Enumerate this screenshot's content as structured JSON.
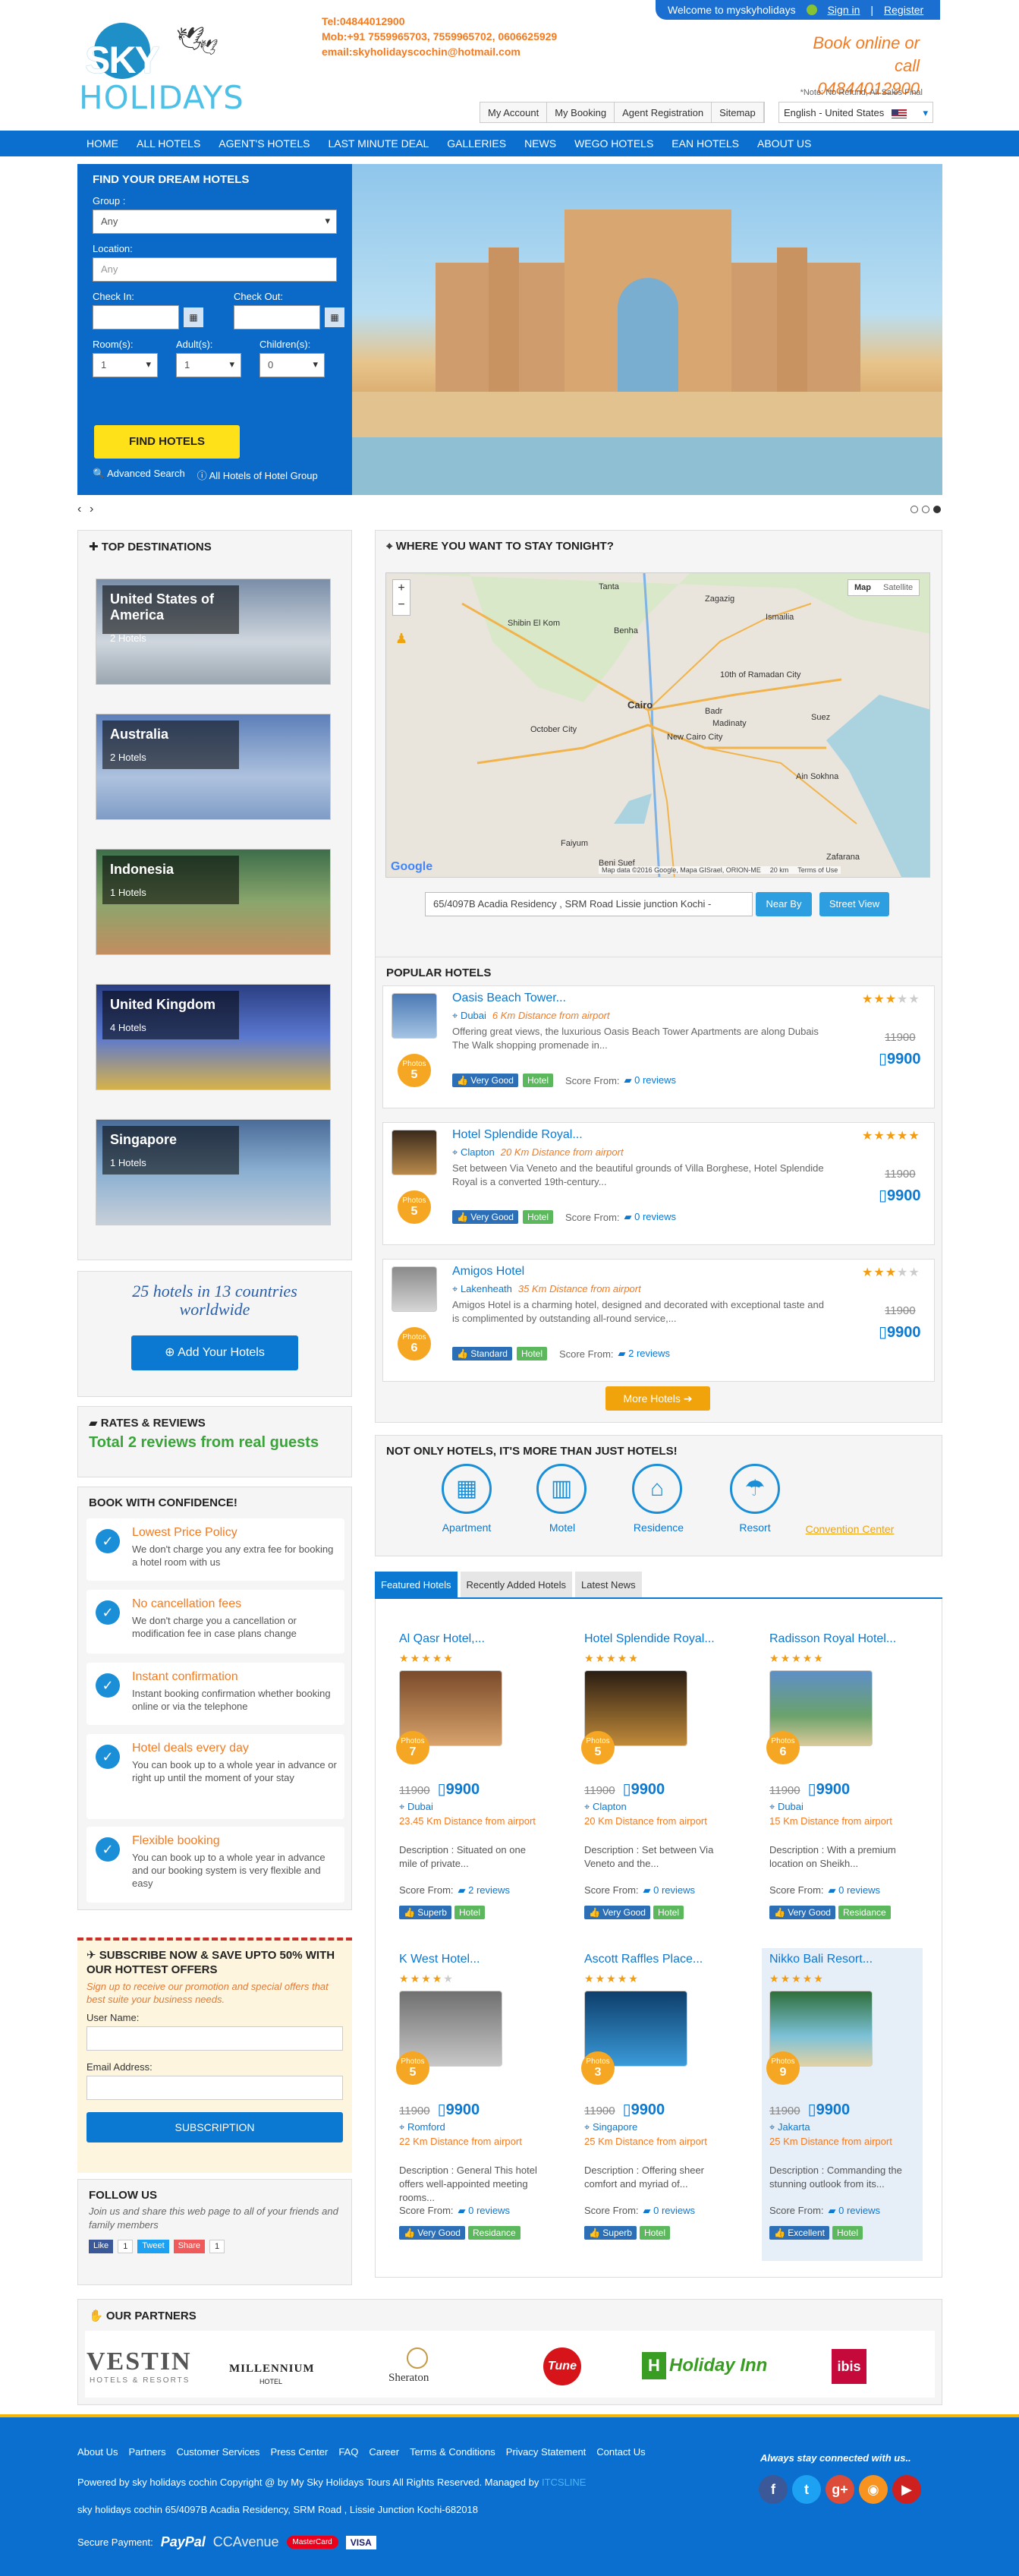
{
  "header": {
    "welcome": "Welcome to myskyholidays",
    "sign_in": "Sign in",
    "register": "Register",
    "logo_top": "SKY",
    "logo_bottom": "HOLIDAYS",
    "tel": "Tel:04844012900",
    "mob": "Mob:+91 7559965703, 7559965702, 0606625929",
    "email": "email:skyholidayscochin@hotmail.com",
    "book_online": "Book online or call",
    "phone": "04844012900",
    "note": "*Note: No Refund, All Sales Final",
    "top_links": [
      "My Account",
      "My Booking",
      "Agent Registration",
      "Sitemap"
    ],
    "language": "English - United States"
  },
  "nav": [
    "HOME",
    "ALL HOTELS",
    "AGENT'S HOTELS",
    "LAST MINUTE DEAL",
    "GALLERIES",
    "NEWS",
    "WEGO HOTELS",
    "EAN HOTELS",
    "ABOUT US"
  ],
  "search": {
    "title": "FIND YOUR DREAM HOTELS",
    "group_label": "Group :",
    "group_value": "Any",
    "location_label": "Location:",
    "location_placeholder": "Any",
    "checkin_label": "Check In:",
    "checkout_label": "Check Out:",
    "rooms_label": "Room(s):",
    "adults_label": "Adult(s):",
    "children_label": "Children(s):",
    "rooms_value": "1",
    "adults_value": "1",
    "children_value": "0",
    "button": "FIND HOTELS",
    "advanced": "Advanced Search",
    "all_hotels": "All Hotels of Hotel Group"
  },
  "destinations": {
    "title": "TOP DESTINATIONS",
    "items": [
      {
        "name": "United States of America",
        "count": "2 Hotels"
      },
      {
        "name": "Australia",
        "count": "2 Hotels"
      },
      {
        "name": "Indonesia",
        "count": "1 Hotels"
      },
      {
        "name": "United Kingdom",
        "count": "4 Hotels"
      },
      {
        "name": "Singapore",
        "count": "1 Hotels"
      }
    ]
  },
  "stats": {
    "text": "25 hotels in 13 countries worldwide",
    "add_button": "Add Your Hotels"
  },
  "reviews": {
    "title": "RATES & REVIEWS",
    "total": "Total 2 reviews from real guests"
  },
  "confidence": {
    "title": "BOOK WITH CONFIDENCE!",
    "items": [
      {
        "title": "Lowest Price Policy",
        "desc": "We don't charge you any extra fee for booking a hotel room with us"
      },
      {
        "title": "No cancellation fees",
        "desc": "We don't charge you a cancellation or modification fee in case plans change"
      },
      {
        "title": "Instant confirmation",
        "desc": "Instant booking confirmation whether booking online or via the telephone"
      },
      {
        "title": "Hotel deals every day",
        "desc": "You can book up to a whole year in advance or right up until the moment of your stay"
      },
      {
        "title": "Flexible booking",
        "desc": "You can book up to a whole year in advance and our booking system is very flexible and easy"
      }
    ]
  },
  "subscribe": {
    "title": "SUBSCRIBE NOW & SAVE UPTO 50% WITH OUR HOTTEST OFFERS",
    "desc": "Sign up to receive our promotion and special offers that best suite your business needs.",
    "user_label": "User Name:",
    "email_label": "Email Address:",
    "button": "SUBSCRIPTION"
  },
  "follow": {
    "title": "FOLLOW US",
    "desc": "Join us and share this web page to all of your friends and family members",
    "like": "Like",
    "like_count": "1",
    "tweet": "Tweet",
    "share": "Share",
    "share_count": "1"
  },
  "map": {
    "title": "WHERE YOU WANT TO STAY TONIGHT?",
    "type_map": "Map",
    "type_sat": "Satellite",
    "address": "65/4097B Acadia Residency , SRM Road Lissie junction Kochi -",
    "near_by": "Near By",
    "street_view": "Street View",
    "credit": "Map data ©2016 Google, Mapa GISrael, ORION-ME",
    "scale": "20 km",
    "terms": "Terms of Use",
    "google": "Google",
    "places": [
      "Tanta",
      "Zagazig",
      "Ismailia",
      "Cairo",
      "October City",
      "New Cairo City",
      "10th of Ramadan City",
      "Suez",
      "Faiyum",
      "Beni Suef",
      "Zafarana",
      "Ain Sokhna",
      "Badr",
      "Benha",
      "Shibin El Kom",
      "Madinaty"
    ]
  },
  "popular": {
    "title": "POPULAR HOTELS",
    "score_label": "Score From:",
    "more_button": "More Hotels",
    "items": [
      {
        "name": "Oasis Beach Tower...",
        "city": "Dubai",
        "distance": "6 Km Distance from airport",
        "desc": "Offering great views, the luxurious Oasis Beach Tower Apartments are along Dubais The Walk shopping promenade in...",
        "rating": 3,
        "photos": "5",
        "badge": "Very Good",
        "tag": "Hotel",
        "reviews": "0 reviews",
        "old_price": "11900",
        "price": "9900"
      },
      {
        "name": "Hotel Splendide Royal...",
        "city": "Clapton",
        "distance": "20 Km Distance from airport",
        "desc": "Set between Via Veneto and the beautiful grounds of Villa Borghese, Hotel Splendide Royal is a converted 19th-century...",
        "rating": 5,
        "photos": "5",
        "badge": "Very Good",
        "tag": "Hotel",
        "reviews": "0 reviews",
        "old_price": "11900",
        "price": "9900"
      },
      {
        "name": "Amigos Hotel",
        "city": "Lakenheath",
        "distance": "35 Km Distance from airport",
        "desc": "Amigos Hotel is a charming hotel, designed and decorated with exceptional taste and is complimented by outstanding all-round service,...",
        "rating": 3,
        "photos": "6",
        "badge": "Standard",
        "tag": "Hotel",
        "reviews": "2 reviews",
        "old_price": "11900",
        "price": "9900"
      }
    ]
  },
  "categories": {
    "title": "NOT ONLY HOTELS, IT'S MORE THAN JUST HOTELS!",
    "items": [
      "Apartment",
      "Motel",
      "Residence",
      "Resort",
      "Convention Center"
    ]
  },
  "featured": {
    "tabs": [
      "Featured Hotels",
      "Recently Added Hotels",
      "Latest News"
    ],
    "photos_label": "Photos",
    "score_label": "Score From:",
    "items": [
      {
        "name": "Al Qasr Hotel,...",
        "rating": 5,
        "photos": "7",
        "old_price": "11900",
        "price": "9900",
        "city": "Dubai",
        "distance": "23.45 Km Distance from airport",
        "desc": "Description : Situated on one mile of private...",
        "reviews": "2 reviews",
        "badge": "Superb",
        "tag": "Hotel"
      },
      {
        "name": "Hotel Splendide Royal...",
        "rating": 5,
        "photos": "5",
        "old_price": "11900",
        "price": "9900",
        "city": "Clapton",
        "distance": "20 Km Distance from airport",
        "desc": "Description : Set between Via Veneto and the...",
        "reviews": "0 reviews",
        "badge": "Very Good",
        "tag": "Hotel"
      },
      {
        "name": "Radisson Royal Hotel...",
        "rating": 5,
        "photos": "6",
        "old_price": "11900",
        "price": "9900",
        "city": "Dubai",
        "distance": "15 Km Distance from airport",
        "desc": "Description : With a premium location on Sheikh...",
        "reviews": "0 reviews",
        "badge": "Very Good",
        "tag": "Residance"
      },
      {
        "name": "K West Hotel...",
        "rating": 4,
        "photos": "5",
        "old_price": "11900",
        "price": "9900",
        "city": "Romford",
        "distance": "22 Km Distance from airport",
        "desc": "Description : General This hotel offers well-appointed meeting rooms...",
        "reviews": "0 reviews",
        "badge": "Very Good",
        "tag": "Residance"
      },
      {
        "name": "Ascott Raffles Place...",
        "rating": 5,
        "photos": "3",
        "old_price": "11900",
        "price": "9900",
        "city": "Singapore",
        "distance": "25 Km Distance from airport",
        "desc": "Description : Offering sheer comfort and myriad of...",
        "reviews": "0 reviews",
        "badge": "Superb",
        "tag": "Hotel"
      },
      {
        "name": "Nikko Bali Resort...",
        "rating": 5,
        "photos": "9",
        "old_price": "11900",
        "price": "9900",
        "city": "Jakarta",
        "distance": "25 Km Distance from airport",
        "desc": "Description : Commanding the stunning outlook from its...",
        "reviews": "0 reviews",
        "badge": "Excellent",
        "tag": "Hotel"
      }
    ]
  },
  "partners": {
    "title": "OUR PARTNERS",
    "items": [
      "VESTIN",
      "HOTELS & RESORTS",
      "MILLENNIUM",
      "HOTEL",
      "Sheraton",
      "Tune",
      "Holiday Inn",
      "ibis"
    ]
  },
  "footer": {
    "links": [
      "About Us",
      "Partners",
      "Customer Services",
      "Press Center",
      "FAQ",
      "Career",
      "Terms & Conditions",
      "Privacy Statement",
      "Contact Us"
    ],
    "powered": "Powered by sky holidays cochin Copyright @ by My Sky Holidays Tours All Rights Reserved. Managed by",
    "managed": "ITCSLINE",
    "address": "sky holidays cochin 65/4097B Acadia Residency, SRM Road , Lissie Junction Kochi-682018",
    "secure": "Secure Payment:",
    "payments": [
      "PayPal",
      "CCAvenue",
      "MasterCard",
      "VISA"
    ],
    "stay": "Always stay connected with us.."
  },
  "colors": {
    "primary": "#0a6fcf",
    "accent": "#f47a20",
    "yellow": "#ffe11a",
    "footer_border": "#f7b500"
  }
}
